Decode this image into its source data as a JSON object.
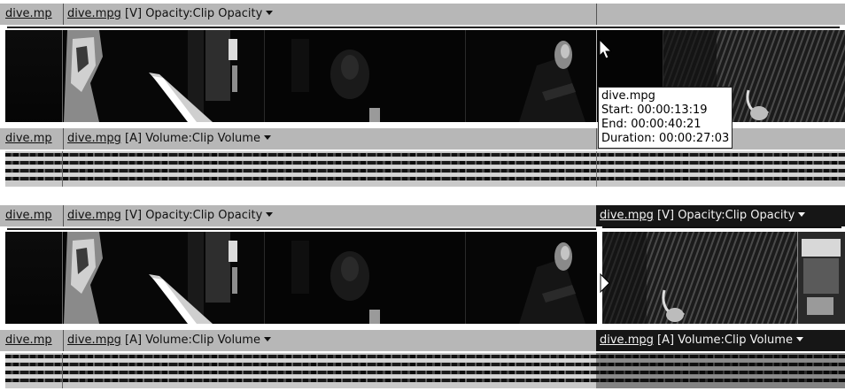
{
  "panels": [
    {
      "video_track": {
        "clips": [
          {
            "name": "dive.mp",
            "suffix": "",
            "effect": ""
          },
          {
            "name": "dive.mpg",
            "suffix": "[V]",
            "effect": "Opacity:Clip Opacity"
          }
        ]
      },
      "audio_track": {
        "clips": [
          {
            "name": "dive.mp",
            "suffix": "",
            "effect": ""
          },
          {
            "name": "dive.mpg",
            "suffix": "[A]",
            "effect": "Volume:Clip Volume"
          }
        ]
      },
      "tooltip": {
        "title": "dive.mpg",
        "start": "Start: 00:00:13:19",
        "end": "End: 00:00:40:21",
        "duration": "Duration: 00:00:27:03"
      }
    },
    {
      "video_track": {
        "clips": [
          {
            "name": "dive.mp",
            "suffix": "",
            "effect": ""
          },
          {
            "name": "dive.mpg",
            "suffix": "[V]",
            "effect": "Opacity:Clip Opacity"
          },
          {
            "name": "dive.mpg",
            "suffix": "[V]",
            "effect": "Opacity:Clip Opacity"
          }
        ]
      },
      "audio_track": {
        "clips": [
          {
            "name": "dive.mp",
            "suffix": "",
            "effect": ""
          },
          {
            "name": "dive.mpg",
            "suffix": "[A]",
            "effect": "Volume:Clip Volume"
          },
          {
            "name": "dive.mpg",
            "suffix": "[A]",
            "effect": "Volume:Clip Volume"
          }
        ]
      }
    }
  ],
  "colors": {
    "label_bar": "#b7b7b7",
    "selected_label_bar": "#161616",
    "audio_bg": "#c9c9c9"
  },
  "icons": [
    "dropdown-arrow-icon",
    "mouse-pointer-icon",
    "trim-cursor-icon"
  ]
}
